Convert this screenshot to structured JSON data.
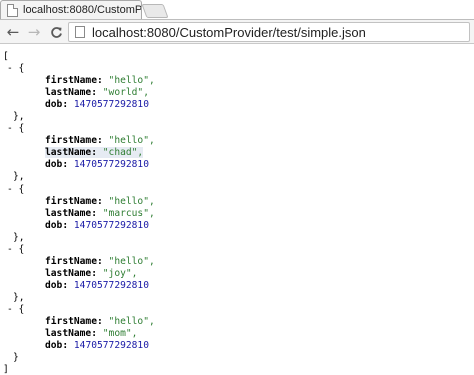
{
  "tab": {
    "title": "localhost:8080/CustomPr"
  },
  "toolbar": {
    "back_glyph": "←",
    "forward_glyph": "→",
    "reload_glyph": "C",
    "url": "localhost:8080/CustomProvider/test/simple.json"
  },
  "json": {
    "open_bracket": "[",
    "close_bracket": "]",
    "toggle": "- {",
    "obj_close": "},",
    "last_close": "}",
    "keys": {
      "first": "firstName:",
      "last": "lastName:",
      "dob": "dob:"
    },
    "records": [
      {
        "firstName": "\"hello\",",
        "lastName": "\"world\",",
        "dob": "1470577292810"
      },
      {
        "firstName": "\"hello\",",
        "lastName": "\"chad\",",
        "dob": "1470577292810"
      },
      {
        "firstName": "\"hello\",",
        "lastName": "\"marcus\",",
        "dob": "1470577292810"
      },
      {
        "firstName": "\"hello\",",
        "lastName": "\"joy\",",
        "dob": "1470577292810"
      },
      {
        "firstName": "\"hello\",",
        "lastName": "\"mom\",",
        "dob": "1470577292810"
      }
    ]
  }
}
